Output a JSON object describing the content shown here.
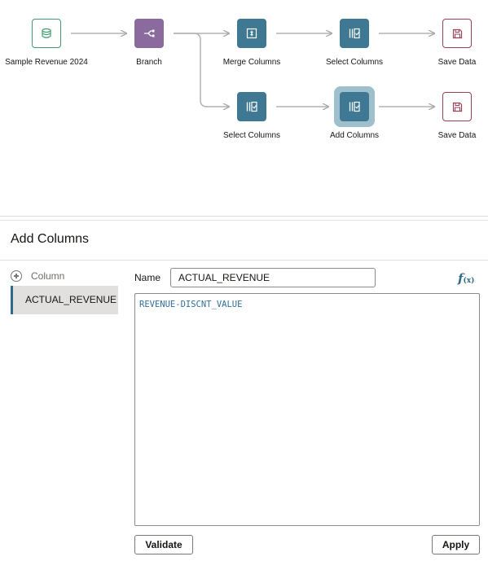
{
  "flow": {
    "nodes": [
      {
        "id": "sample-revenue",
        "label": "Sample Revenue 2024",
        "icon": "database-icon"
      },
      {
        "id": "branch",
        "label": "Branch",
        "icon": "branch-icon"
      },
      {
        "id": "merge-columns",
        "label": "Merge Columns",
        "icon": "merge-icon"
      },
      {
        "id": "select-columns-1",
        "label": "Select Columns",
        "icon": "select-columns-icon"
      },
      {
        "id": "save-data-1",
        "label": "Save Data",
        "icon": "save-icon"
      },
      {
        "id": "select-columns-2",
        "label": "Select Columns",
        "icon": "select-columns-icon"
      },
      {
        "id": "add-columns",
        "label": "Add Columns",
        "icon": "add-columns-icon",
        "selected": true
      },
      {
        "id": "save-data-2",
        "label": "Save Data",
        "icon": "save-icon"
      }
    ]
  },
  "panel": {
    "title": "Add Columns",
    "column_list": {
      "header": "Column",
      "items": [
        "ACTUAL_REVENUE"
      ]
    },
    "name_label": "Name",
    "name_value": "ACTUAL_REVENUE",
    "expression": "REVENUE-DISCNT_VALUE",
    "validate_label": "Validate",
    "apply_label": "Apply",
    "fx_main": "f",
    "fx_sub": "(x)"
  },
  "colors": {
    "source": "#3f9d6d",
    "branch": "#8b6a9e",
    "transform": "#3e7893",
    "save": "#9b3f55",
    "selected_ring": "#9fbfcd",
    "accent": "#2d6b8a"
  }
}
